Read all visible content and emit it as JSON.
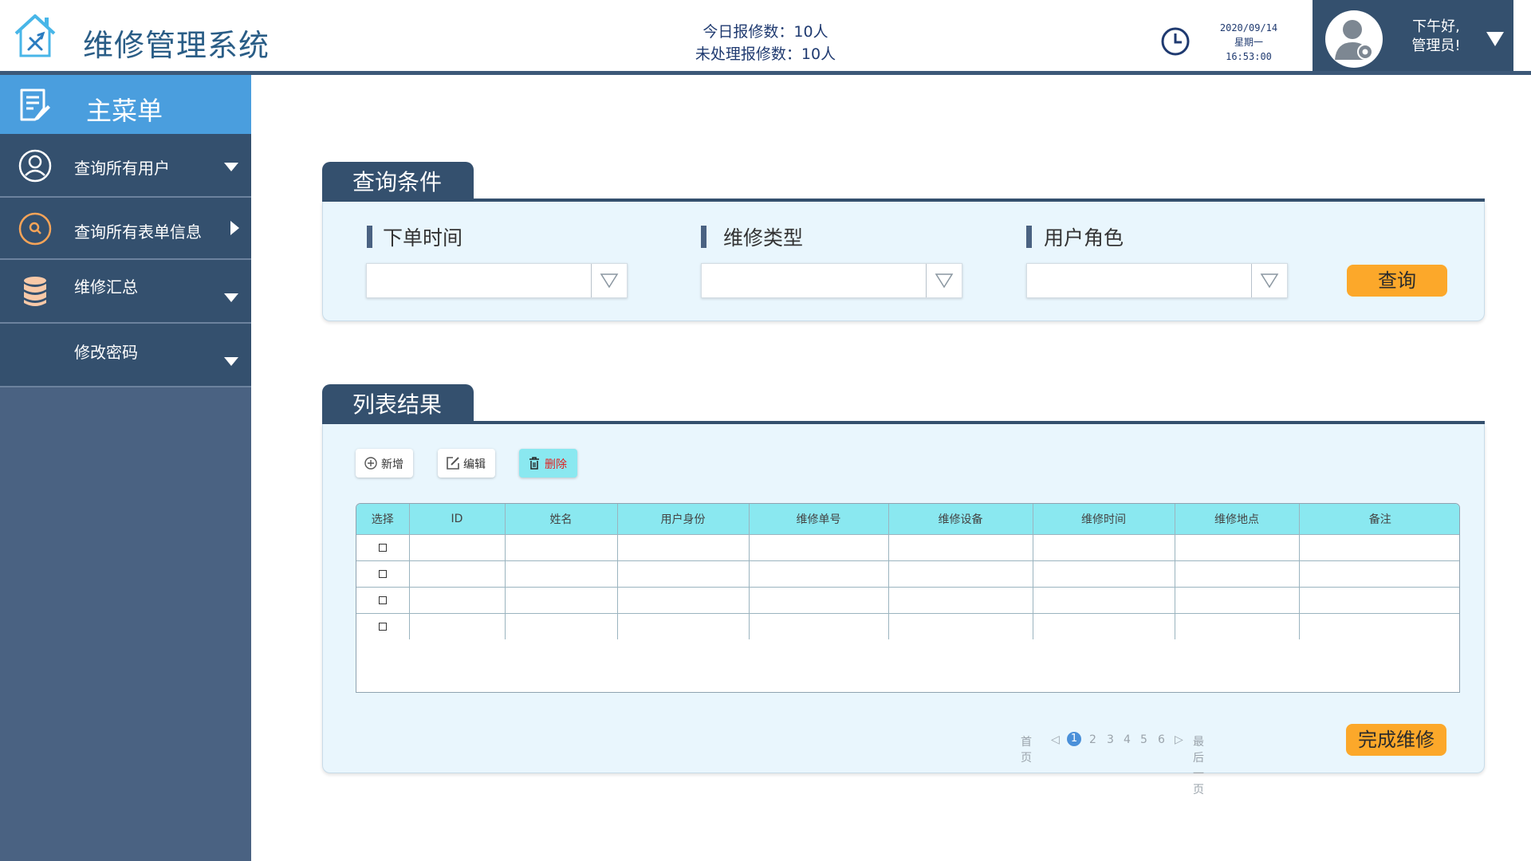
{
  "header": {
    "title": "维修管理系统",
    "today_reports": "今日报修数：10人",
    "unprocessed_reports": "未处理报修数：10人",
    "date": "2020/09/14",
    "weekday": "星期一",
    "time": "16:53:00",
    "greeting_line1": "下午好,",
    "greeting_line2": "管理员!"
  },
  "sidebar": {
    "head_label": "主菜单",
    "items": [
      {
        "label": "查询所有用户",
        "icon": "user-circle-icon",
        "arrow": "down"
      },
      {
        "label": "查询所有表单信息",
        "icon": "search-circle-icon",
        "arrow": "right"
      },
      {
        "label": "维修汇总",
        "icon": "database-icon",
        "arrow": "down"
      },
      {
        "label": "修改密码",
        "icon": "",
        "arrow": "down"
      }
    ]
  },
  "query_panel": {
    "tab": "查询条件",
    "fields": [
      {
        "label": "下单时间",
        "value": ""
      },
      {
        "label": "维修类型",
        "value": ""
      },
      {
        "label": "用户角色",
        "value": ""
      }
    ],
    "query_button": "查询"
  },
  "result_panel": {
    "tab": "列表结果",
    "toolbar": {
      "add": "新增",
      "edit": "编辑",
      "delete": "删除"
    },
    "columns": [
      "选择",
      "ID",
      "姓名",
      "用户身份",
      "维修单号",
      "维修设备",
      "维修时间",
      "维修地点",
      "备注"
    ],
    "rows": [
      [
        "",
        "",
        "",
        "",
        "",
        "",
        "",
        ""
      ],
      [
        "",
        "",
        "",
        "",
        "",
        "",
        "",
        ""
      ],
      [
        "",
        "",
        "",
        "",
        "",
        "",
        "",
        ""
      ],
      [
        "",
        "",
        "",
        "",
        "",
        "",
        "",
        ""
      ]
    ],
    "pager": {
      "first": "首页",
      "pages": [
        "1",
        "2",
        "3",
        "4",
        "5",
        "6"
      ],
      "current": "1",
      "last": "最后一页"
    },
    "complete_button": "完成维修"
  },
  "colors": {
    "header_blue": "#2a5d86",
    "sidebar_dark": "#34506e",
    "sidebar_body": "#4a6282",
    "menu_head": "#4a9ede",
    "accent_orange": "#fca82a",
    "table_header": "#8ae8f0",
    "panel_bg": "#e9f6fd",
    "delete_red": "#e02020"
  }
}
